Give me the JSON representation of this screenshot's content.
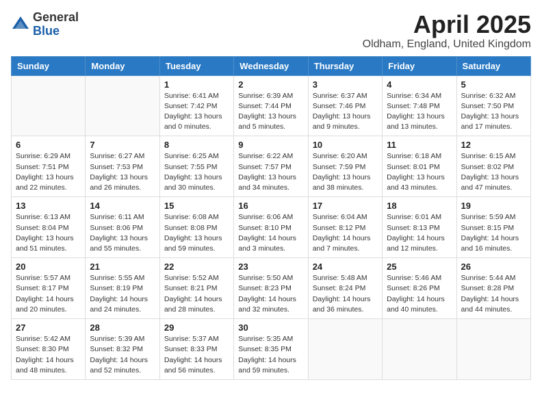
{
  "logo": {
    "general": "General",
    "blue": "Blue"
  },
  "title": "April 2025",
  "location": "Oldham, England, United Kingdom",
  "days_of_week": [
    "Sunday",
    "Monday",
    "Tuesday",
    "Wednesday",
    "Thursday",
    "Friday",
    "Saturday"
  ],
  "weeks": [
    [
      {
        "day": "",
        "info": ""
      },
      {
        "day": "",
        "info": ""
      },
      {
        "day": "1",
        "info": "Sunrise: 6:41 AM\nSunset: 7:42 PM\nDaylight: 13 hours and 0 minutes."
      },
      {
        "day": "2",
        "info": "Sunrise: 6:39 AM\nSunset: 7:44 PM\nDaylight: 13 hours and 5 minutes."
      },
      {
        "day": "3",
        "info": "Sunrise: 6:37 AM\nSunset: 7:46 PM\nDaylight: 13 hours and 9 minutes."
      },
      {
        "day": "4",
        "info": "Sunrise: 6:34 AM\nSunset: 7:48 PM\nDaylight: 13 hours and 13 minutes."
      },
      {
        "day": "5",
        "info": "Sunrise: 6:32 AM\nSunset: 7:50 PM\nDaylight: 13 hours and 17 minutes."
      }
    ],
    [
      {
        "day": "6",
        "info": "Sunrise: 6:29 AM\nSunset: 7:51 PM\nDaylight: 13 hours and 22 minutes."
      },
      {
        "day": "7",
        "info": "Sunrise: 6:27 AM\nSunset: 7:53 PM\nDaylight: 13 hours and 26 minutes."
      },
      {
        "day": "8",
        "info": "Sunrise: 6:25 AM\nSunset: 7:55 PM\nDaylight: 13 hours and 30 minutes."
      },
      {
        "day": "9",
        "info": "Sunrise: 6:22 AM\nSunset: 7:57 PM\nDaylight: 13 hours and 34 minutes."
      },
      {
        "day": "10",
        "info": "Sunrise: 6:20 AM\nSunset: 7:59 PM\nDaylight: 13 hours and 38 minutes."
      },
      {
        "day": "11",
        "info": "Sunrise: 6:18 AM\nSunset: 8:01 PM\nDaylight: 13 hours and 43 minutes."
      },
      {
        "day": "12",
        "info": "Sunrise: 6:15 AM\nSunset: 8:02 PM\nDaylight: 13 hours and 47 minutes."
      }
    ],
    [
      {
        "day": "13",
        "info": "Sunrise: 6:13 AM\nSunset: 8:04 PM\nDaylight: 13 hours and 51 minutes."
      },
      {
        "day": "14",
        "info": "Sunrise: 6:11 AM\nSunset: 8:06 PM\nDaylight: 13 hours and 55 minutes."
      },
      {
        "day": "15",
        "info": "Sunrise: 6:08 AM\nSunset: 8:08 PM\nDaylight: 13 hours and 59 minutes."
      },
      {
        "day": "16",
        "info": "Sunrise: 6:06 AM\nSunset: 8:10 PM\nDaylight: 14 hours and 3 minutes."
      },
      {
        "day": "17",
        "info": "Sunrise: 6:04 AM\nSunset: 8:12 PM\nDaylight: 14 hours and 7 minutes."
      },
      {
        "day": "18",
        "info": "Sunrise: 6:01 AM\nSunset: 8:13 PM\nDaylight: 14 hours and 12 minutes."
      },
      {
        "day": "19",
        "info": "Sunrise: 5:59 AM\nSunset: 8:15 PM\nDaylight: 14 hours and 16 minutes."
      }
    ],
    [
      {
        "day": "20",
        "info": "Sunrise: 5:57 AM\nSunset: 8:17 PM\nDaylight: 14 hours and 20 minutes."
      },
      {
        "day": "21",
        "info": "Sunrise: 5:55 AM\nSunset: 8:19 PM\nDaylight: 14 hours and 24 minutes."
      },
      {
        "day": "22",
        "info": "Sunrise: 5:52 AM\nSunset: 8:21 PM\nDaylight: 14 hours and 28 minutes."
      },
      {
        "day": "23",
        "info": "Sunrise: 5:50 AM\nSunset: 8:23 PM\nDaylight: 14 hours and 32 minutes."
      },
      {
        "day": "24",
        "info": "Sunrise: 5:48 AM\nSunset: 8:24 PM\nDaylight: 14 hours and 36 minutes."
      },
      {
        "day": "25",
        "info": "Sunrise: 5:46 AM\nSunset: 8:26 PM\nDaylight: 14 hours and 40 minutes."
      },
      {
        "day": "26",
        "info": "Sunrise: 5:44 AM\nSunset: 8:28 PM\nDaylight: 14 hours and 44 minutes."
      }
    ],
    [
      {
        "day": "27",
        "info": "Sunrise: 5:42 AM\nSunset: 8:30 PM\nDaylight: 14 hours and 48 minutes."
      },
      {
        "day": "28",
        "info": "Sunrise: 5:39 AM\nSunset: 8:32 PM\nDaylight: 14 hours and 52 minutes."
      },
      {
        "day": "29",
        "info": "Sunrise: 5:37 AM\nSunset: 8:33 PM\nDaylight: 14 hours and 56 minutes."
      },
      {
        "day": "30",
        "info": "Sunrise: 5:35 AM\nSunset: 8:35 PM\nDaylight: 14 hours and 59 minutes."
      },
      {
        "day": "",
        "info": ""
      },
      {
        "day": "",
        "info": ""
      },
      {
        "day": "",
        "info": ""
      }
    ]
  ]
}
